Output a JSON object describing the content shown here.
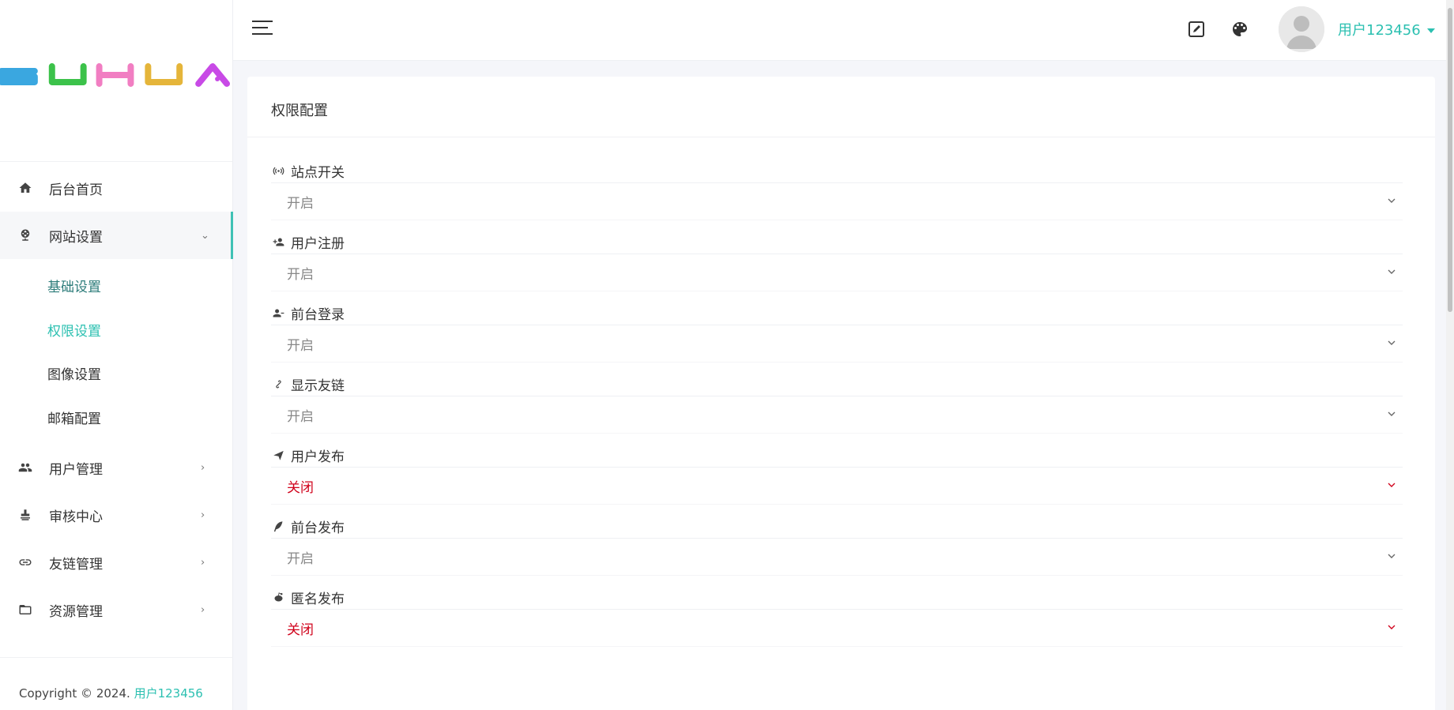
{
  "brand": {
    "logo_text": "SUHUA",
    "logo_colors": [
      "#3aa7e0",
      "#3cc24a",
      "#f17ec2",
      "#e5b53a",
      "#c84ae6"
    ]
  },
  "sidebar": {
    "items": [
      {
        "label": "后台首页",
        "icon": "home-icon"
      },
      {
        "label": "网站设置",
        "icon": "globe-icon",
        "expanded": true,
        "children": [
          "基础设置",
          "权限设置",
          "图像设置",
          "邮箱配置"
        ]
      },
      {
        "label": "用户管理",
        "icon": "users-icon"
      },
      {
        "label": "审核中心",
        "icon": "stamp-icon"
      },
      {
        "label": "友链管理",
        "icon": "link-icon"
      },
      {
        "label": "资源管理",
        "icon": "folder-icon"
      }
    ],
    "active_child": "权限设置",
    "collapse_caret": "⌄",
    "expand_caret": "›"
  },
  "header": {
    "edit_icon": "edit-icon",
    "theme_icon": "palette-icon",
    "username": "用户123456"
  },
  "footer": {
    "copyright": "Copyright © 2024.",
    "user": "用户123456"
  },
  "card": {
    "title": "权限配置",
    "fields": [
      {
        "label": "站点开关",
        "icon": "broadcast-icon",
        "value": "开启"
      },
      {
        "label": "用户注册",
        "icon": "user-plus-icon",
        "value": "开启"
      },
      {
        "label": "前台登录",
        "icon": "user-minus-icon",
        "value": "开启"
      },
      {
        "label": "显示友链",
        "icon": "link-icon",
        "value": "开启"
      },
      {
        "label": "用户发布",
        "icon": "send-icon",
        "value": "关闭"
      },
      {
        "label": "前台发布",
        "icon": "feather-icon",
        "value": "开启"
      },
      {
        "label": "匿名发布",
        "icon": "reddit-icon",
        "value": "关闭"
      }
    ]
  },
  "colors": {
    "accent": "#2cc0b1",
    "closed": "#d0021b"
  }
}
